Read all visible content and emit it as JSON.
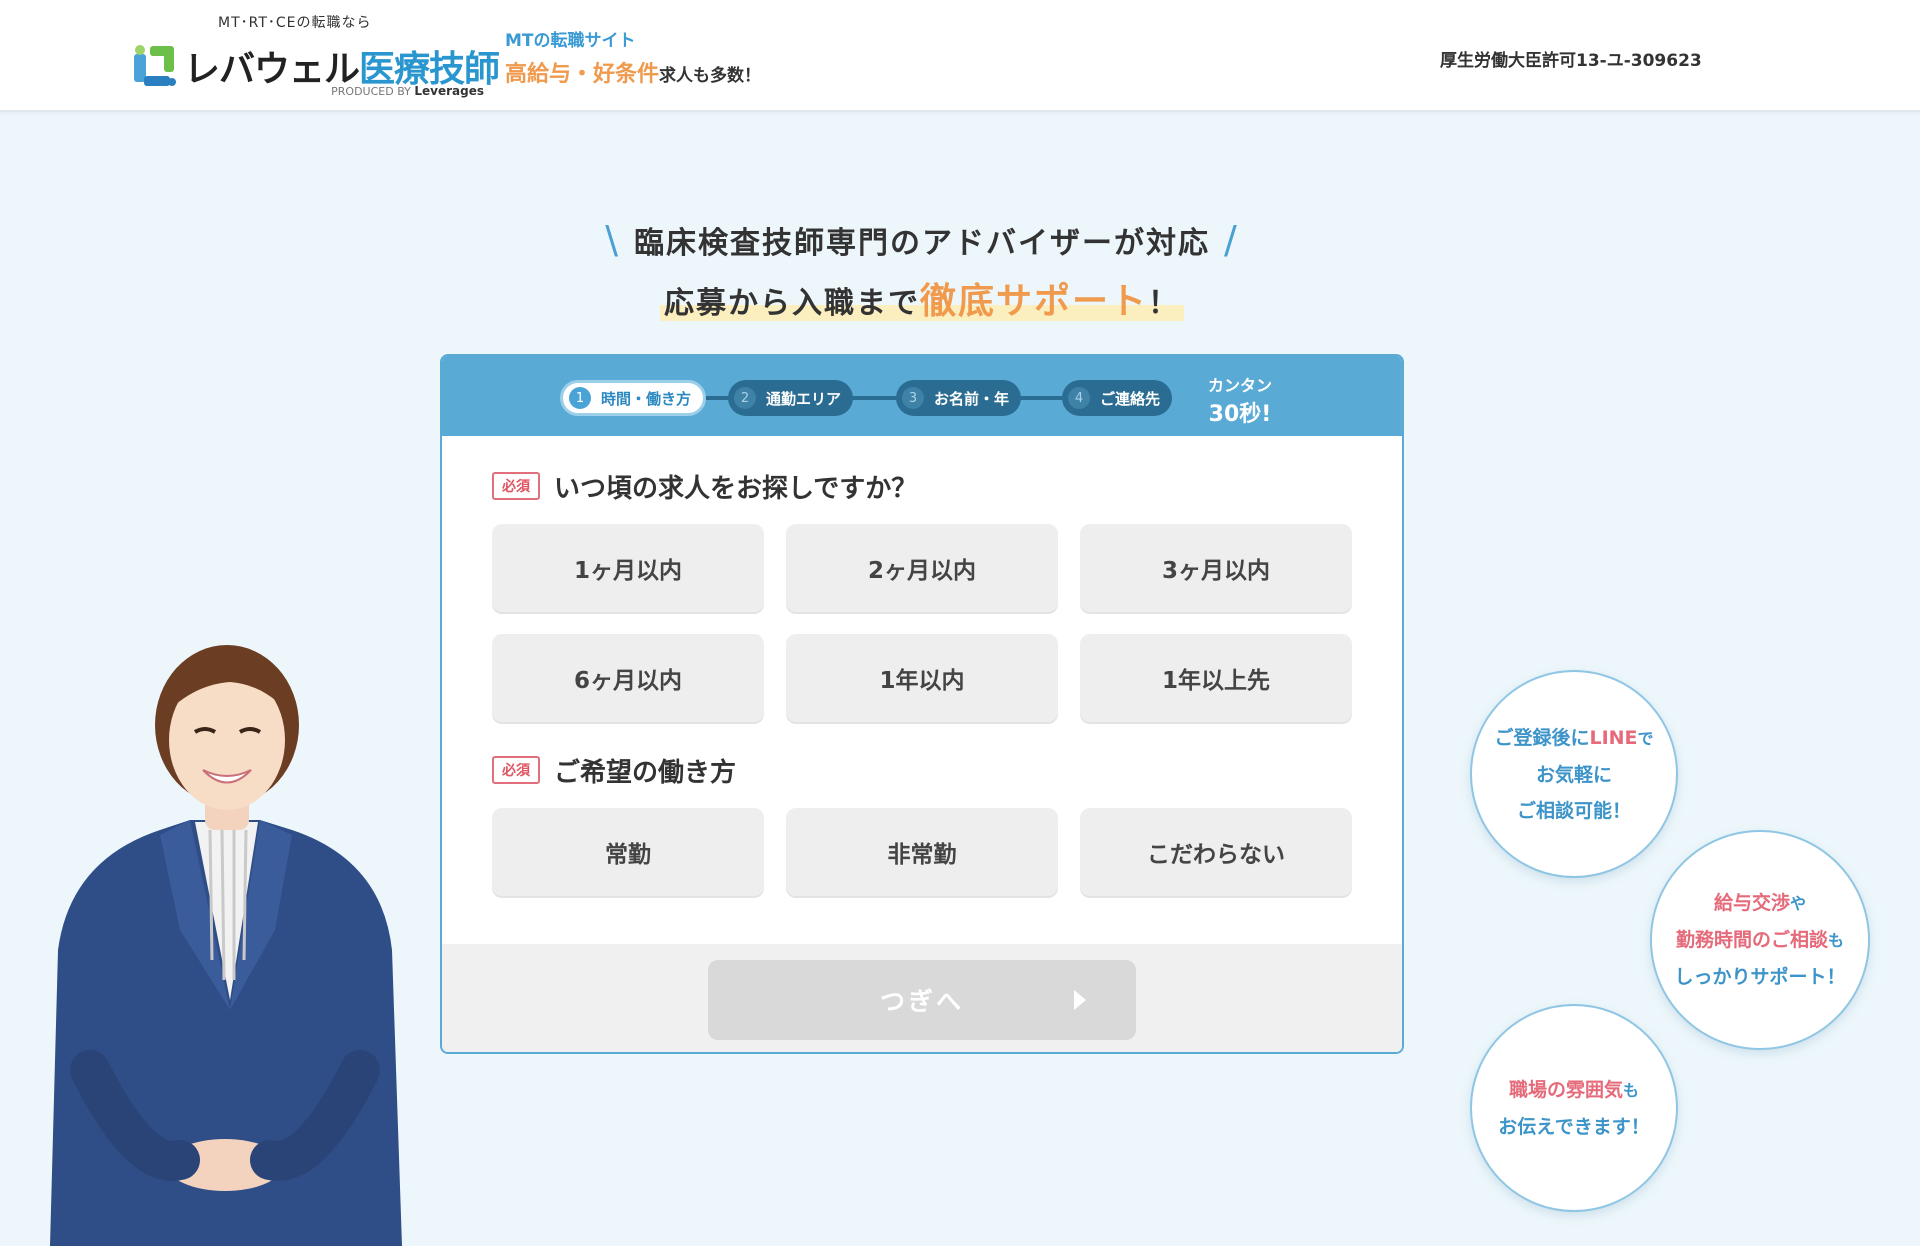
{
  "header": {
    "logo_sub": "MT･RT･CEの転職なら",
    "logo_main_black": "レバウェル",
    "logo_main_blue": "医療技師",
    "logo_produced_prefix": "PRODUCED BY",
    "logo_produced_brand": "Leverages",
    "tagline_1": "MTの転職サイト",
    "tagline_2_highlight": "高給与・好条件",
    "tagline_2_rest": "求人も多数！",
    "license": "厚生労働大臣許可13-ユ-309623"
  },
  "headline": {
    "line1": "臨床検査技師専門のアドバイザーが対応",
    "line2_prefix": "応募から入職まで",
    "line2_highlight": "徹底サポート",
    "line2_suffix": "！",
    "slash_left": "\\",
    "slash_right": "/"
  },
  "steps": [
    {
      "num": "1",
      "label": "時間・働き方",
      "active": true
    },
    {
      "num": "2",
      "label": "通勤エリア",
      "active": false
    },
    {
      "num": "3",
      "label": "お名前・年",
      "active": false
    },
    {
      "num": "4",
      "label": "ご連絡先",
      "active": false
    }
  ],
  "easy": {
    "line1": "カンタン",
    "line2": "30秒!"
  },
  "questions": [
    {
      "required": "必須",
      "text": "いつ頃の求人をお探しですか？",
      "options": [
        "1ヶ月以内",
        "2ヶ月以内",
        "3ヶ月以内",
        "6ヶ月以内",
        "1年以内",
        "1年以上先"
      ]
    },
    {
      "required": "必須",
      "text": "ご希望の働き方",
      "options": [
        "常勤",
        "非常勤",
        "こだわらない"
      ]
    }
  ],
  "next_button": "つぎへ",
  "bubbles": [
    {
      "l1a": "ご登録後に",
      "l1b": "LINE",
      "l1c": "で",
      "l2": "お気軽に",
      "l3": "ご相談可能！"
    },
    {
      "l1a": "給与交渉",
      "l1b": "や",
      "l2a": "勤務時間のご相談",
      "l2b": "も",
      "l3": "しっかりサポート！"
    },
    {
      "l1a": "職場の雰囲気",
      "l1b": "も",
      "l2": "お伝えできます！"
    }
  ],
  "colors": {
    "accent_blue": "#5aaad6",
    "brand_blue": "#2a96cf",
    "highlight_orange": "#ef9a4d",
    "required_red": "#e05563",
    "page_bg": "#edf7fb"
  }
}
